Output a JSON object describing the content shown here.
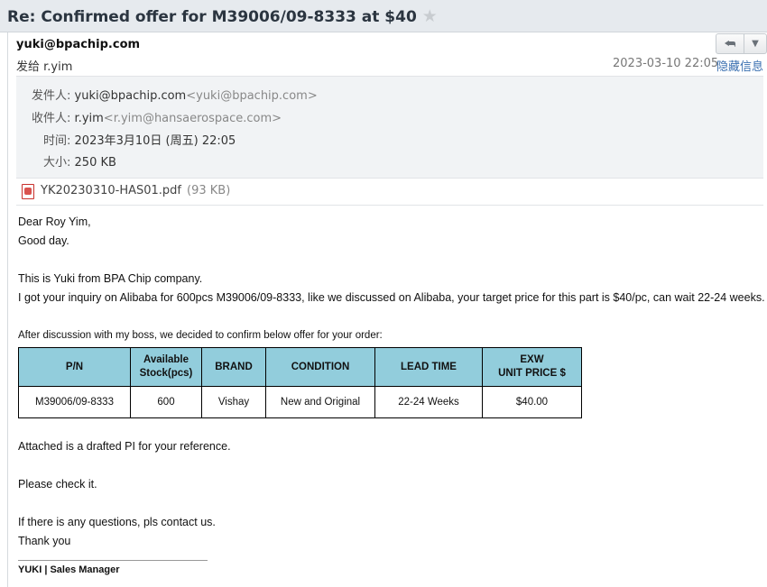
{
  "subject": "Re: Confirmed offer for M39006/09-8333 at $40",
  "header": {
    "sender": "yuki@bpachip.com",
    "to_line": "发给 r.yim",
    "date": "2023-03-10 22:05",
    "hide_details": "隐藏信息"
  },
  "details": {
    "from_label": "发件人:",
    "from_name": "yuki@bpachip.com",
    "from_addr": "<yuki@bpachip.com>",
    "to_label": "收件人:",
    "to_name": "r.yim",
    "to_addr": "<r.yim@hansaerospace.com>",
    "time_label": "时间:",
    "time_value": "2023年3月10日 (周五) 22:05",
    "size_label": "大小:",
    "size_value": "250 KB"
  },
  "attachment": {
    "icon": "pdf-icon",
    "name": "YK20230310-HAS01.pdf",
    "size": "(93 KB)"
  },
  "body": {
    "greeting": "Dear Roy Yim,",
    "good_day": "Good day.",
    "intro": "This is Yuki from BPA Chip company.",
    "inquiry": "I got your inquiry on Alibaba for 600pcs M39006/09-8333, like we discussed on Alibaba, your target price for this part is $40/pc, can wait 22-24 weeks.",
    "offer_intro": "After discussion with my boss, we decided to confirm below offer for your order:",
    "attached": "Attached is a drafted PI for your reference.",
    "check": "Please check it.",
    "questions": "If there is any questions, pls contact us.",
    "thanks": "Thank you",
    "signature": "YUKI  |  Sales Manager"
  },
  "table": {
    "headers": {
      "pn": "P/N",
      "stock_1": "Available",
      "stock_2": "Stock(pcs)",
      "brand": "BRAND",
      "condition": "CONDITION",
      "lead": "LEAD TIME",
      "price_1": "EXW",
      "price_2": "UNIT PRICE $"
    },
    "row": {
      "pn": "M39006/09-8333",
      "stock": "600",
      "brand": "Vishay",
      "condition": "New and Original",
      "lead": "22-24 Weeks",
      "price": "$40.00"
    }
  }
}
